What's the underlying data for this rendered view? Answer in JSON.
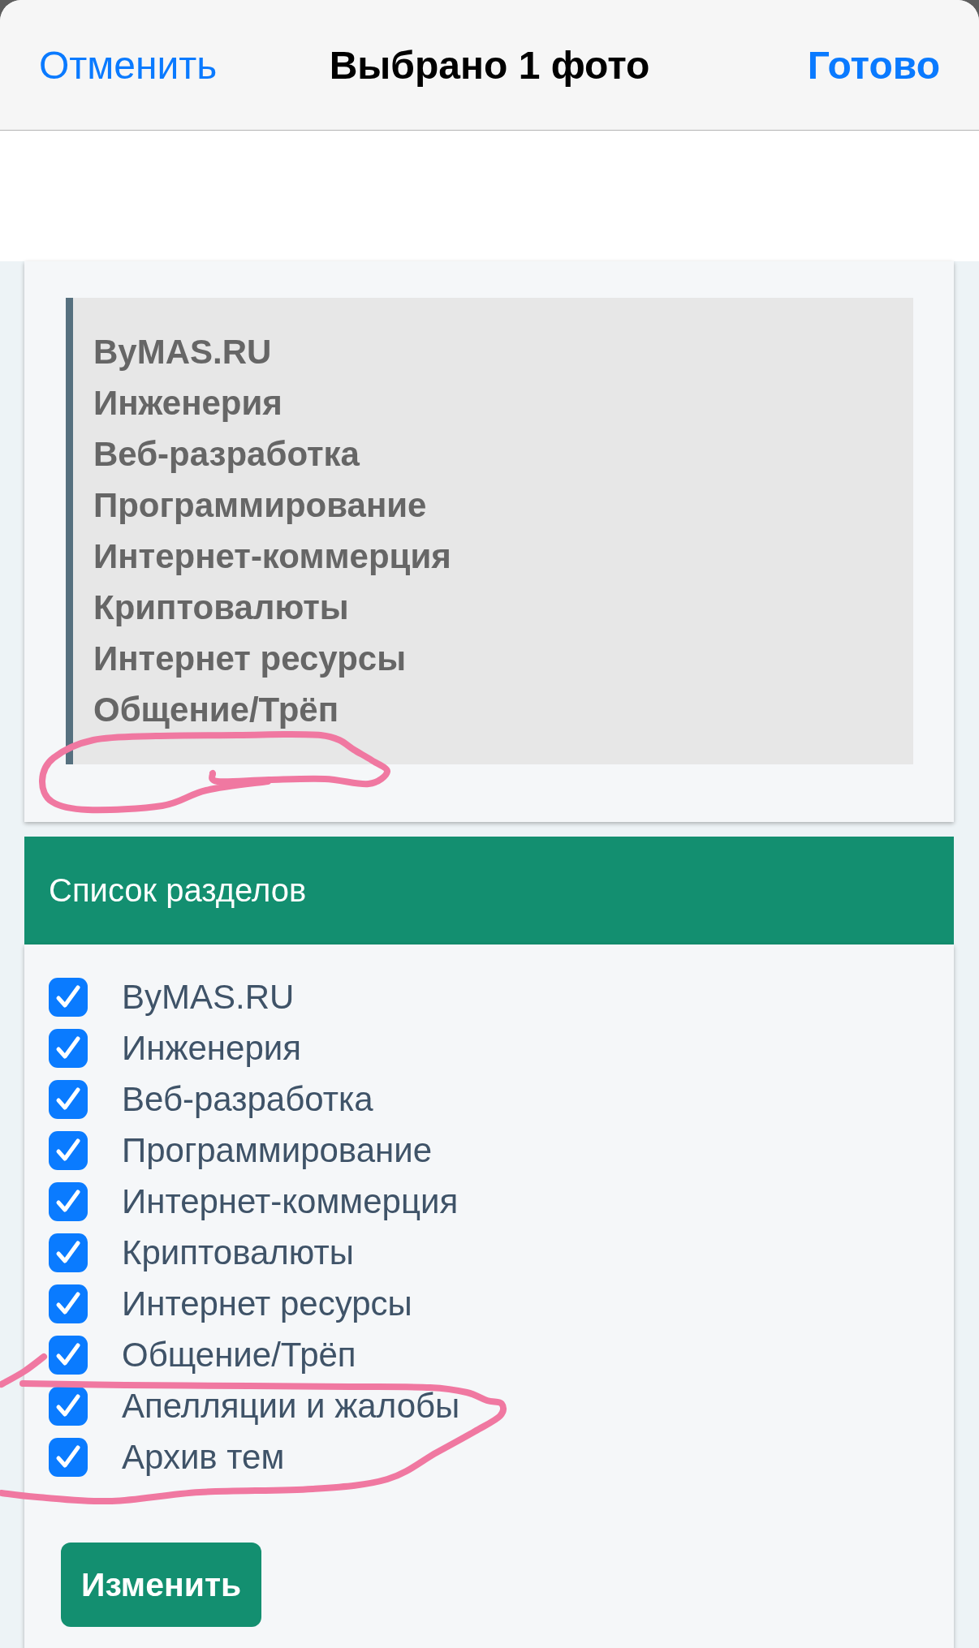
{
  "nav_bar": {
    "cancel": "Отменить",
    "title": "Выбрано 1 фото",
    "done": "Готово"
  },
  "quote": {
    "lines": [
      "ByMAS.RU",
      "Инженерия",
      "Веб-разработка",
      "Программирование",
      "Интернет-коммерция",
      "Криптовалюты",
      "Интернет ресурсы",
      "Общение/Трёп"
    ]
  },
  "sections_panel": {
    "title": "Список разделов",
    "items": [
      {
        "label": "ByMAS.RU",
        "checked": true
      },
      {
        "label": "Инженерия",
        "checked": true
      },
      {
        "label": "Веб-разработка",
        "checked": true
      },
      {
        "label": "Программирование",
        "checked": true
      },
      {
        "label": "Интернет-коммерция",
        "checked": true
      },
      {
        "label": "Криптовалюты",
        "checked": true
      },
      {
        "label": "Интернет ресурсы",
        "checked": true
      },
      {
        "label": "Общение/Трёп",
        "checked": true
      },
      {
        "label": "Апелляции и жалобы",
        "checked": true
      },
      {
        "label": "Архив тем",
        "checked": true
      }
    ],
    "button": "Изменить"
  }
}
